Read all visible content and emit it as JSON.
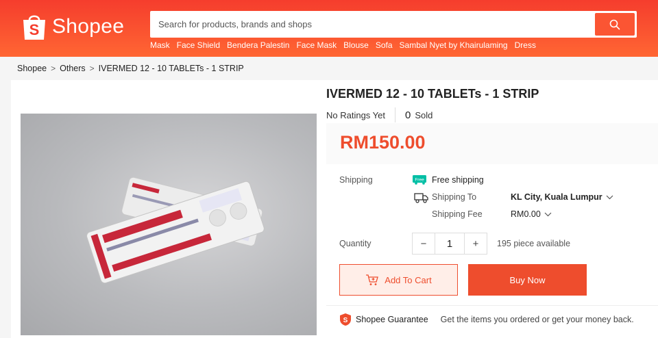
{
  "header": {
    "logo_text": "Shopee",
    "search_placeholder": "Search for products, brands and shops",
    "keywords": [
      "Mask",
      "Face Shield",
      "Bendera Palestin",
      "Face Mask",
      "Blouse",
      "Sofa",
      "Sambal Nyet by Khairulaming",
      "Dress"
    ]
  },
  "breadcrumb": [
    "Shopee",
    "Others",
    "IVERMED 12 - 10 TABLETs - 1 STRIP"
  ],
  "product": {
    "title": "IVERMED 12 - 10 TABLETs - 1 STRIP",
    "ratings": "No Ratings Yet",
    "sold_count": "0",
    "sold_label": "Sold",
    "price": "RM150.00"
  },
  "shipping": {
    "label": "Shipping",
    "free_badge": "Free",
    "free_text": "Free shipping",
    "to_label": "Shipping To",
    "to_value": "KL City, Kuala Lumpur",
    "fee_label": "Shipping Fee",
    "fee_value": "RM0.00"
  },
  "quantity": {
    "label": "Quantity",
    "minus": "−",
    "value": "1",
    "plus": "+",
    "available": "195 piece available"
  },
  "actions": {
    "add_to_cart": "Add To Cart",
    "buy_now": "Buy Now"
  },
  "guarantee": {
    "title": "Shopee Guarantee",
    "desc": "Get the items you ordered or get your money back."
  },
  "colors": {
    "brand": "#ee4d2d",
    "header": "#f53d2d",
    "free_green": "#00bfa5"
  }
}
